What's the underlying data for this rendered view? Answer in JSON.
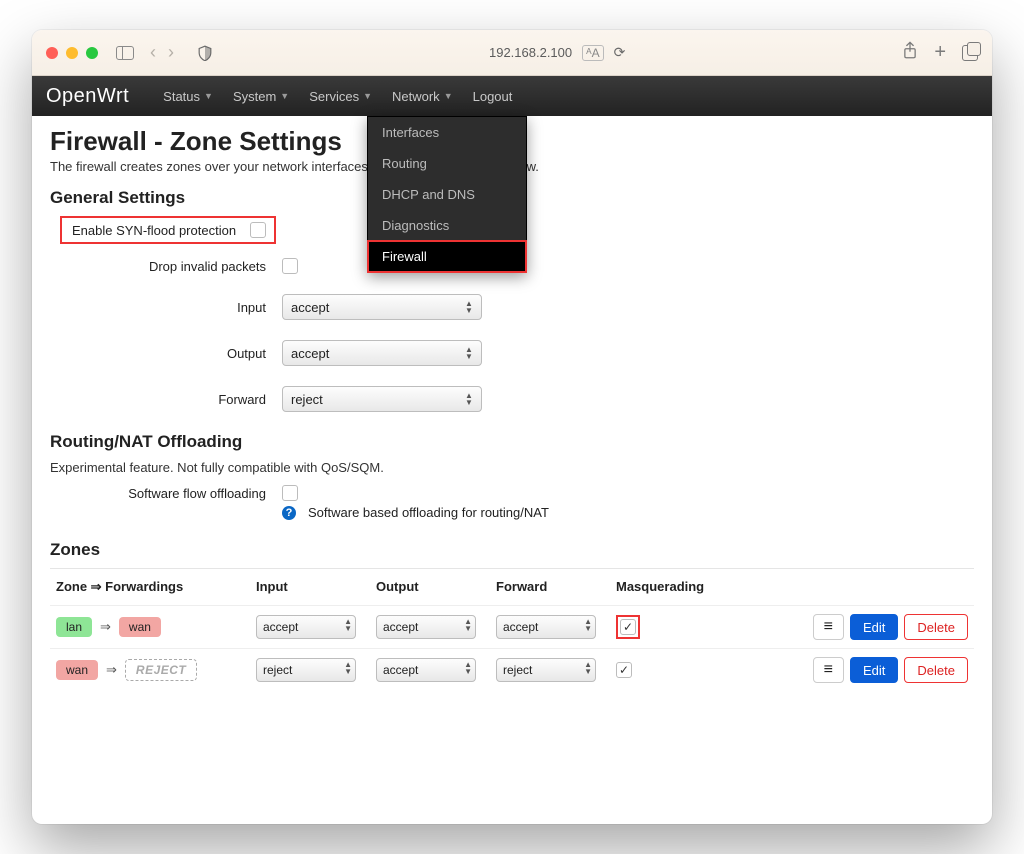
{
  "chrome": {
    "url": "192.168.2.100"
  },
  "nav": {
    "brand": "OpenWrt",
    "items": [
      "Status",
      "System",
      "Services",
      "Network",
      "Logout"
    ],
    "dropdown": {
      "items": [
        "Interfaces",
        "Routing",
        "DHCP and DNS",
        "Diagnostics",
        "Firewall"
      ],
      "active": "Firewall"
    }
  },
  "page": {
    "title": "Firewall - Zone Settings",
    "subtitle": "The firewall creates zones over your network interfaces to control network traffic flow."
  },
  "general": {
    "heading": "General Settings",
    "syn_label": "Enable SYN-flood protection",
    "drop_label": "Drop invalid packets",
    "input_label": "Input",
    "input_value": "accept",
    "output_label": "Output",
    "output_value": "accept",
    "forward_label": "Forward",
    "forward_value": "reject"
  },
  "offload": {
    "heading": "Routing/NAT Offloading",
    "sub": "Experimental feature. Not fully compatible with QoS/SQM.",
    "sfo_label": "Software flow offloading",
    "help": "Software based offloading for routing/NAT"
  },
  "zones": {
    "heading": "Zones",
    "cols": {
      "zone": "Zone ⇒ Forwardings",
      "input": "Input",
      "output": "Output",
      "forward": "Forward",
      "masq": "Masquerading"
    },
    "rows": [
      {
        "from": "lan",
        "from_class": "lan",
        "to": "wan",
        "to_class": "wan",
        "input": "accept",
        "output": "accept",
        "forward": "accept",
        "masq": true,
        "masq_highlight": true
      },
      {
        "from": "wan",
        "from_class": "wan",
        "to": "REJECT",
        "to_class": "reject",
        "input": "reject",
        "output": "accept",
        "forward": "reject",
        "masq": true,
        "masq_highlight": false
      }
    ],
    "actions": {
      "menu": "≡",
      "edit": "Edit",
      "delete": "Delete"
    }
  }
}
